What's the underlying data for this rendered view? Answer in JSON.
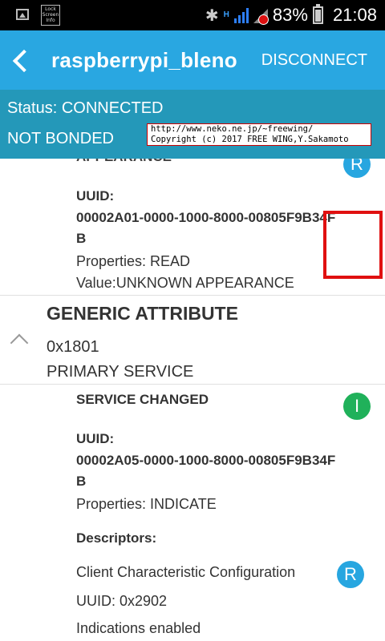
{
  "statusbar": {
    "lock_label": "Lock Screen Info",
    "network_type": "H",
    "battery_percent": "83%",
    "time": "21:08"
  },
  "appbar": {
    "title": "raspberrypi_bleno",
    "disconnect_label": "DISCONNECT"
  },
  "connection": {
    "status": "Status: CONNECTED",
    "bond": "NOT BONDED"
  },
  "watermark": {
    "line1": "http://www.neko.ne.jp/~freewing/",
    "line2": "Copyright (c) 2017 FREE WING,Y.Sakamoto"
  },
  "characteristic_1": {
    "name": "APPEARANCE",
    "badge": "R",
    "uuid_label": "UUID:",
    "uuid_line1": "00002A01-0000-1000-8000-00805F9B34F",
    "uuid_line2": "B",
    "properties": "Properties: READ",
    "value": "Value:UNKNOWN APPEARANCE"
  },
  "service": {
    "name": "GENERIC ATTRIBUTE",
    "short_uuid": "0x1801",
    "type": "PRIMARY SERVICE"
  },
  "characteristic_2": {
    "name": "SERVICE CHANGED",
    "badge": "I",
    "uuid_label": "UUID:",
    "uuid_line1": "00002A05-0000-1000-8000-00805F9B34F",
    "uuid_line2": "B",
    "properties": "Properties: INDICATE",
    "descriptors_label": "Descriptors:",
    "descriptor": {
      "name": "Client Characteristic Configuration",
      "badge": "R",
      "uuid": "UUID: 0x2902",
      "value": "Indications enabled"
    }
  },
  "colors": {
    "appbar": "#29a7e1",
    "status_band": "#2498b9",
    "read_badge": "#27a6e0",
    "indicate_badge": "#20b15a",
    "highlight": "#e01010"
  }
}
